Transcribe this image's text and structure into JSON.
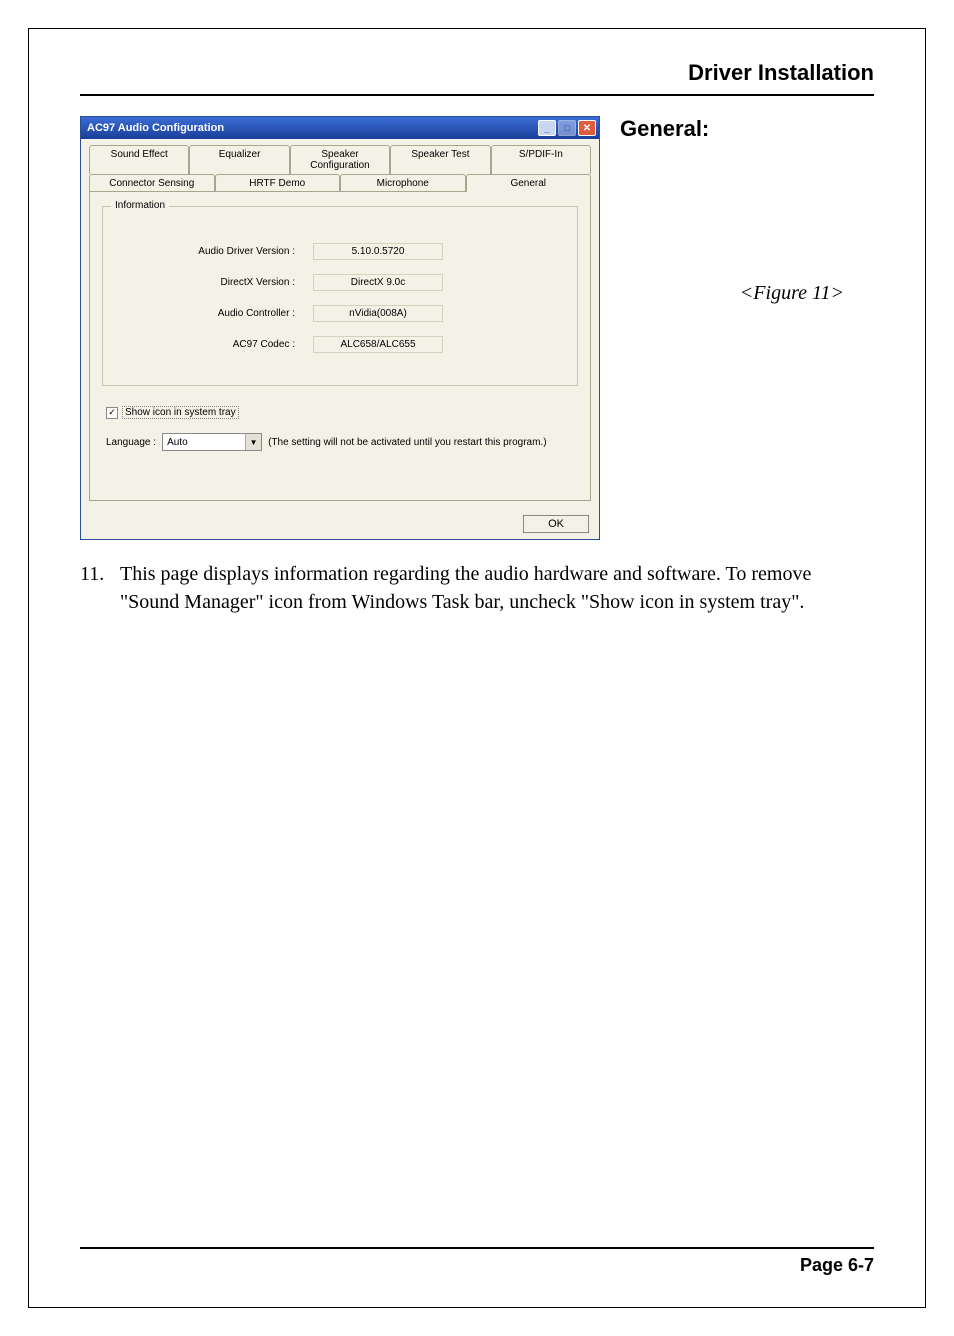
{
  "page": {
    "header": "Driver Installation",
    "footer": "Page 6-7"
  },
  "side": {
    "label": "General:",
    "figure": "<Figure 11>"
  },
  "ac97": {
    "title": "AC97 Audio Configuration",
    "tabs_row1": [
      "Sound Effect",
      "Equalizer",
      "Speaker Configuration",
      "Speaker Test",
      "S/PDIF-In"
    ],
    "tabs_row2": [
      "Connector Sensing",
      "HRTF Demo",
      "Microphone",
      "General"
    ],
    "fieldset_legend": "Information",
    "info": [
      {
        "label": "Audio Driver Version :",
        "value": "5.10.0.5720"
      },
      {
        "label": "DirectX Version :",
        "value": "DirectX 9.0c"
      },
      {
        "label": "Audio Controller :",
        "value": "nVidia(008A)"
      },
      {
        "label": "AC97 Codec :",
        "value": "ALC658/ALC655"
      }
    ],
    "checkbox_label": "Show icon in system tray",
    "language_label": "Language :",
    "language_value": "Auto",
    "language_hint": "(The setting will not be activated until you restart this program.)",
    "ok": "OK"
  },
  "body": {
    "num": "11.",
    "text": "This page displays information regarding the audio hardware and software. To remove \"Sound Manager\" icon from Windows Task bar, uncheck \"Show icon in system tray\"."
  }
}
